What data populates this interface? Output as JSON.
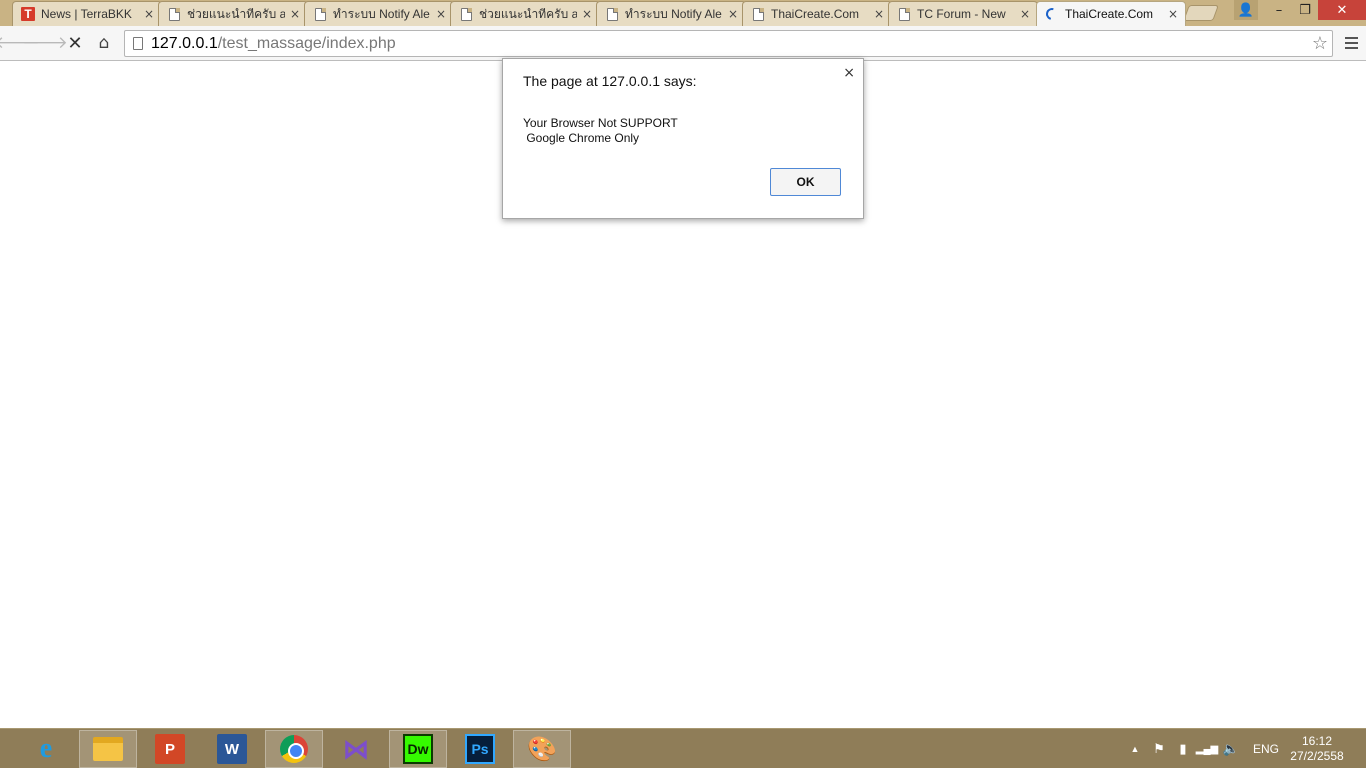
{
  "browser": {
    "tabs": [
      {
        "label": "News | TerraBKK",
        "favicon": "terrabkk-favicon",
        "close": "×"
      },
      {
        "label": "ช่วยแนะนำทีครับ ale",
        "favicon": "page-icon",
        "close": "×"
      },
      {
        "label": "ทำระบบ Notify Ale",
        "favicon": "page-icon",
        "close": "×"
      },
      {
        "label": "ช่วยแนะนำทีครับ ale",
        "favicon": "page-icon",
        "close": "×"
      },
      {
        "label": "ทำระบบ Notify Ale",
        "favicon": "page-icon",
        "close": "×"
      },
      {
        "label": "ThaiCreate.Com",
        "favicon": "page-icon",
        "close": "×"
      },
      {
        "label": "TC Forum - New",
        "favicon": "page-icon",
        "close": "×"
      },
      {
        "label": "ThaiCreate.Com",
        "favicon": "loading-spinner-icon",
        "close": "×",
        "active": true
      }
    ],
    "window_controls": {
      "user": "👤",
      "minimize": "–",
      "maximize": "❐",
      "close": "✕"
    },
    "toolbar": {
      "back": "🡐",
      "forward": "🡒",
      "stop": "✕",
      "home": "⌂",
      "url_host": "127.0.0.1",
      "url_path": "/test_massage/index.php",
      "star": "☆"
    }
  },
  "dialog": {
    "title": "The page at 127.0.0.1 says:",
    "close": "×",
    "message": "Your Browser Not SUPPORT\n Google Chrome Only",
    "ok_label": "OK"
  },
  "taskbar": {
    "apps": [
      {
        "name": "internet-explorer-icon",
        "glyph": "e"
      },
      {
        "name": "file-explorer-icon",
        "glyph": ""
      },
      {
        "name": "powerpoint-icon",
        "glyph": "P"
      },
      {
        "name": "word-icon",
        "glyph": "W"
      },
      {
        "name": "chrome-icon",
        "glyph": ""
      },
      {
        "name": "visual-studio-icon",
        "glyph": "⋈"
      },
      {
        "name": "dreamweaver-icon",
        "glyph": "Dw"
      },
      {
        "name": "photoshop-icon",
        "glyph": "Ps"
      },
      {
        "name": "paint-icon",
        "glyph": "🎨"
      }
    ],
    "tray": {
      "chevron": "▲",
      "flag": "⚑",
      "power": "▮",
      "signal": "▂▄▆",
      "volume": "🔈",
      "language": "ENG"
    },
    "clock": {
      "time": "16:12",
      "date": "27/2/2558"
    }
  },
  "colors": {
    "accent": "#4f88d6",
    "titlebar": "#c9b384",
    "taskbar": "#8f7d58"
  }
}
